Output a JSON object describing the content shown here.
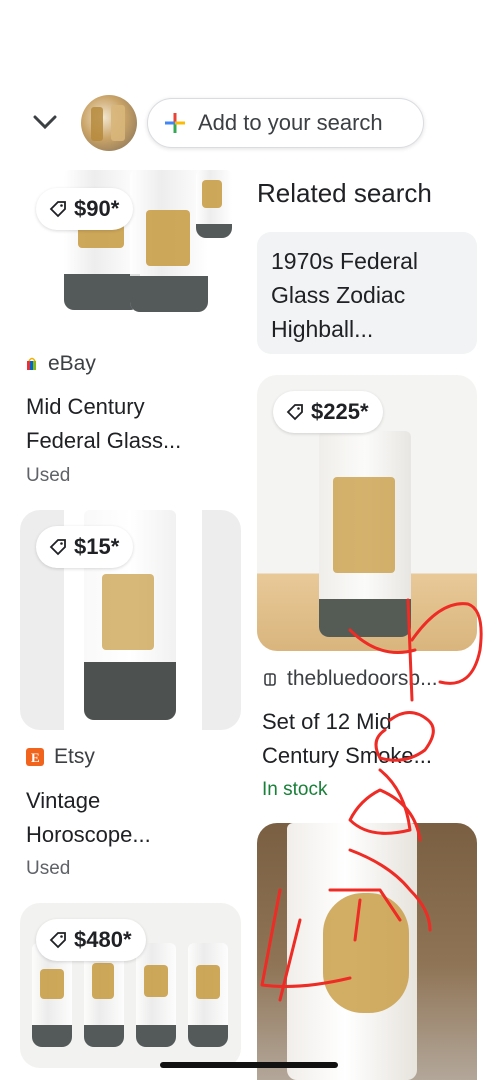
{
  "search_bar": {
    "add_label": "Add to your search"
  },
  "left_column": [
    {
      "price": "$90*",
      "source": "eBay",
      "title_line1": "Mid Century",
      "title_line2": "Federal Glass...",
      "condition": "Used"
    },
    {
      "price": "$15*",
      "source": "Etsy",
      "title_line1": "Vintage",
      "title_line2": "Horoscope...",
      "condition": "Used"
    },
    {
      "price": "$480*"
    }
  ],
  "right_column": {
    "related_heading": "Related search",
    "related_query_line1": "1970s Federal",
    "related_query_line2": "Glass Zodiac",
    "related_query_line3": "Highball...",
    "card1": {
      "price": "$225*",
      "source": "thebluedoorsb...",
      "title_line1": "Set of 12 Mid",
      "title_line2": "Century Smoke...",
      "stock": "In stock"
    }
  },
  "colors": {
    "in_stock": "#188038",
    "scribble": "#ee2b24",
    "etsy": "#f1641e"
  }
}
